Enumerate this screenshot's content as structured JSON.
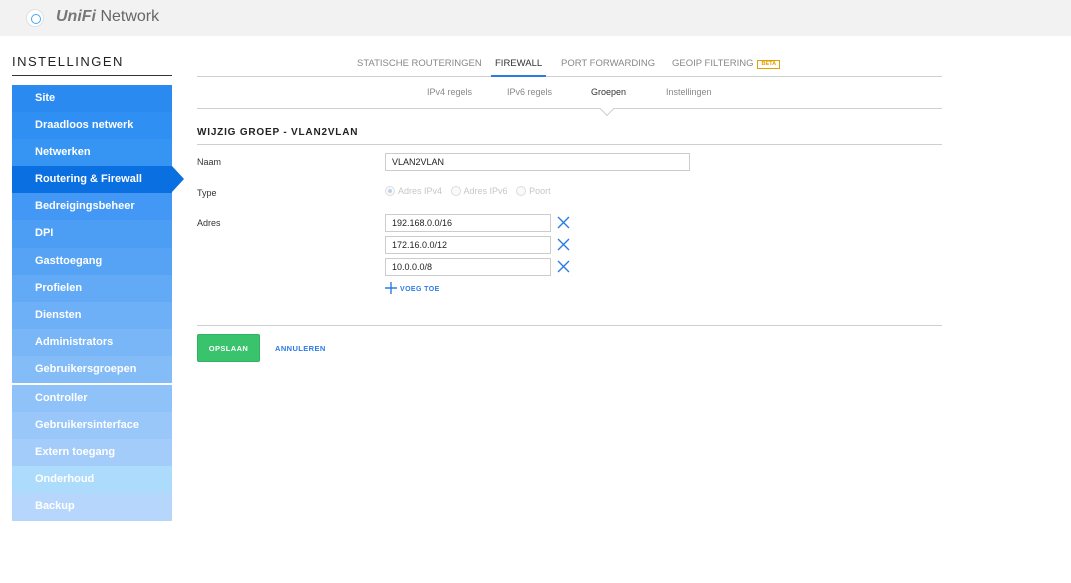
{
  "app": {
    "brand_unifi": "UniFi",
    "brand_name": "Network"
  },
  "sidebar": {
    "title": "INSTELLINGEN",
    "items": [
      {
        "label": "Site",
        "color": "#2b8af0"
      },
      {
        "label": "Draadloos netwerk",
        "color": "#2f8ff2"
      },
      {
        "label": "Netwerken",
        "color": "#3694f3"
      },
      {
        "label": "Routering & Firewall",
        "color": "#0a6fe0",
        "active": true
      },
      {
        "label": "Bedreigingsbeheer",
        "color": "#4298f4"
      },
      {
        "label": "DPI",
        "color": "#4c9ef5"
      },
      {
        "label": "Gasttoegang",
        "color": "#56a3f5"
      },
      {
        "label": "Profielen",
        "color": "#62aaf6"
      },
      {
        "label": "Diensten",
        "color": "#6eb0f7"
      },
      {
        "label": "Administrators",
        "color": "#79b6f8"
      },
      {
        "label": "Gebruikersgroepen",
        "color": "#84bcf8"
      },
      {
        "label": "Controller",
        "color": "#8fc2f9"
      },
      {
        "label": "Gebruikersinterface",
        "color": "#99c7f9"
      },
      {
        "label": "Extern toegang",
        "color": "#a3ccfa"
      },
      {
        "label": "Onderhoud",
        "color": "#addbfc"
      },
      {
        "label": "Backup",
        "color": "#b7d6fb"
      }
    ]
  },
  "tabs": [
    {
      "label": "STATISCHE ROUTERINGEN"
    },
    {
      "label": "FIREWALL",
      "active": true
    },
    {
      "label": "PORT FORWARDING"
    },
    {
      "label": "GEOIP FILTERING",
      "badge": "BETA"
    }
  ],
  "subtabs": [
    {
      "label": "IPv4 regels"
    },
    {
      "label": "IPv6 regels"
    },
    {
      "label": "Groepen",
      "active": true
    },
    {
      "label": "Instellingen"
    }
  ],
  "form": {
    "title": "WIJZIG GROEP - VLAN2VLAN",
    "name_label": "Naam",
    "name_value": "VLAN2VLAN",
    "type_label": "Type",
    "type_options": [
      {
        "label": "Adres IPv4",
        "checked": true
      },
      {
        "label": "Adres IPv6"
      },
      {
        "label": "Poort"
      }
    ],
    "address_label": "Adres",
    "addresses": [
      "192.168.0.0/16",
      "172.16.0.0/12",
      "10.0.0.0/8"
    ],
    "add_label": "VOEG TOE",
    "save_label": "OPSLAAN",
    "cancel_label": "ANNULEREN"
  },
  "icons": {
    "remove": "close-icon",
    "add": "plus-icon",
    "logo": "ubiquiti-logo-icon"
  },
  "colors": {
    "accent": "#2c7be5",
    "save": "#3ac36d",
    "beta": "#e0a000"
  }
}
